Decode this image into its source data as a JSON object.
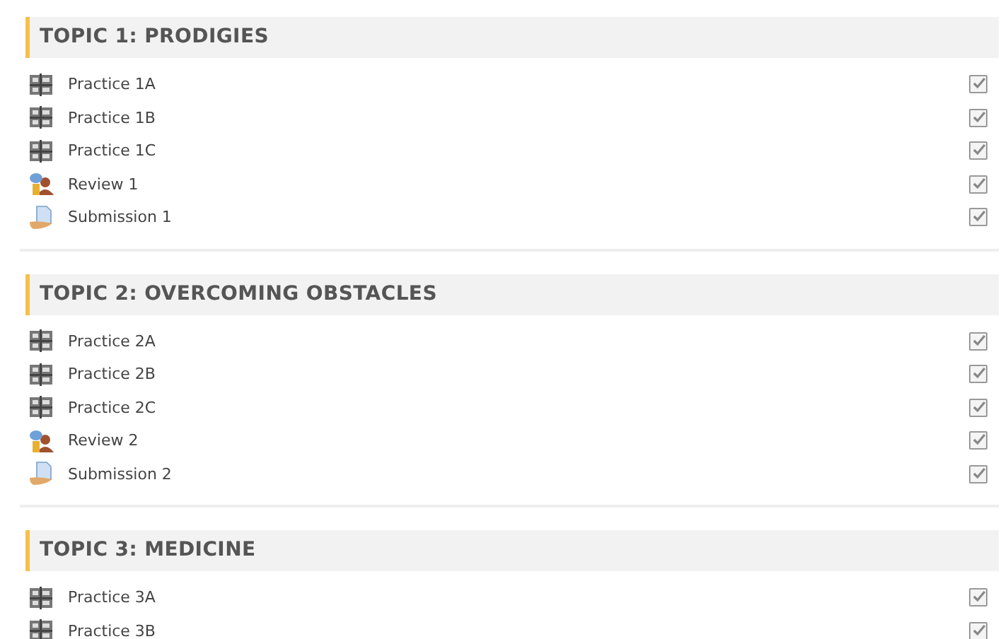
{
  "topics": [
    {
      "title": "TOPIC 1: PRODIGIES",
      "activities": [
        {
          "kind": "practice",
          "label": "Practice 1A",
          "checked": true
        },
        {
          "kind": "practice",
          "label": "Practice 1B",
          "checked": true
        },
        {
          "kind": "practice",
          "label": "Practice 1C",
          "checked": true
        },
        {
          "kind": "review",
          "label": "Review 1",
          "checked": true
        },
        {
          "kind": "submission",
          "label": "Submission 1",
          "checked": true
        }
      ]
    },
    {
      "title": "TOPIC 2: OVERCOMING OBSTACLES",
      "activities": [
        {
          "kind": "practice",
          "label": "Practice 2A",
          "checked": true
        },
        {
          "kind": "practice",
          "label": "Practice 2B",
          "checked": true
        },
        {
          "kind": "practice",
          "label": "Practice 2C",
          "checked": true
        },
        {
          "kind": "review",
          "label": "Review 2",
          "checked": true
        },
        {
          "kind": "submission",
          "label": "Submission 2",
          "checked": true
        }
      ]
    },
    {
      "title": "TOPIC 3: MEDICINE",
      "activities": [
        {
          "kind": "practice",
          "label": "Practice 3A",
          "checked": true
        },
        {
          "kind": "practice",
          "label": "Practice 3B",
          "checked": true
        }
      ]
    }
  ]
}
